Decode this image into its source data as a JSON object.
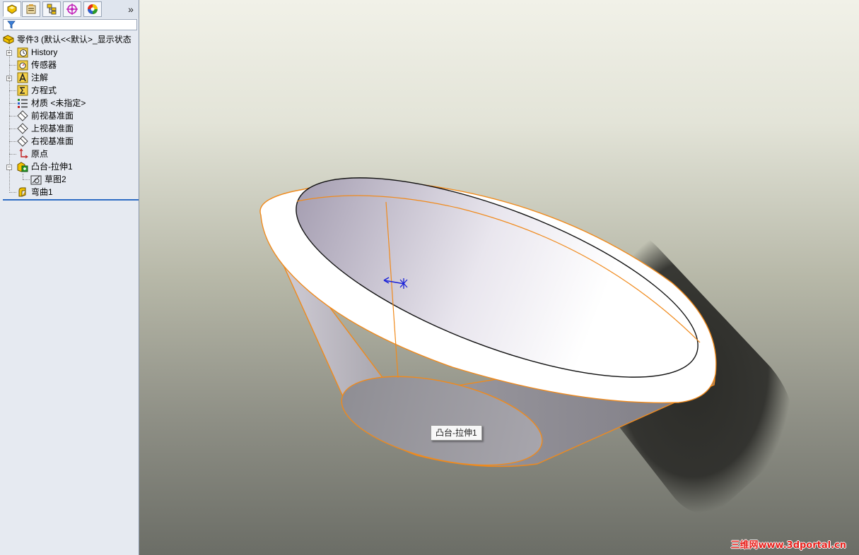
{
  "panel": {
    "tabs": [
      {
        "icon": "feature-manager-icon"
      },
      {
        "icon": "property-manager-icon"
      },
      {
        "icon": "configuration-manager-icon"
      },
      {
        "icon": "dimxpert-icon"
      },
      {
        "icon": "display-manager-icon"
      }
    ],
    "more_label": "»",
    "filter_icon": "filter-icon",
    "tree": {
      "root": "零件3  (默认<<默认>_显示状态",
      "items": [
        {
          "label": "History",
          "icon": "history-icon"
        },
        {
          "label": "传感器",
          "icon": "sensor-icon"
        },
        {
          "label": "注解",
          "icon": "annotation-icon"
        },
        {
          "label": "方程式",
          "icon": "equation-icon"
        },
        {
          "label": "材质 <未指定>",
          "icon": "material-icon"
        },
        {
          "label": "前视基准面",
          "icon": "plane-icon"
        },
        {
          "label": "上视基准面",
          "icon": "plane-icon"
        },
        {
          "label": "右视基准面",
          "icon": "plane-icon"
        },
        {
          "label": "原点",
          "icon": "origin-icon"
        },
        {
          "label": "凸台-拉伸1",
          "icon": "extrude-icon"
        },
        {
          "label": "草图2",
          "icon": "sketch-icon"
        },
        {
          "label": "弯曲1",
          "icon": "flex-icon"
        }
      ]
    }
  },
  "viewport": {
    "tooltip": "凸台-拉伸1",
    "watermark": "三维网www.3dportal.cn"
  },
  "colors": {
    "selection_edge": "#f08a1c",
    "panel_bg": "#e6eaf1",
    "rollback_bar": "#2e6cc4",
    "triad": "#1a22d8",
    "watermark": "#e8201c"
  }
}
